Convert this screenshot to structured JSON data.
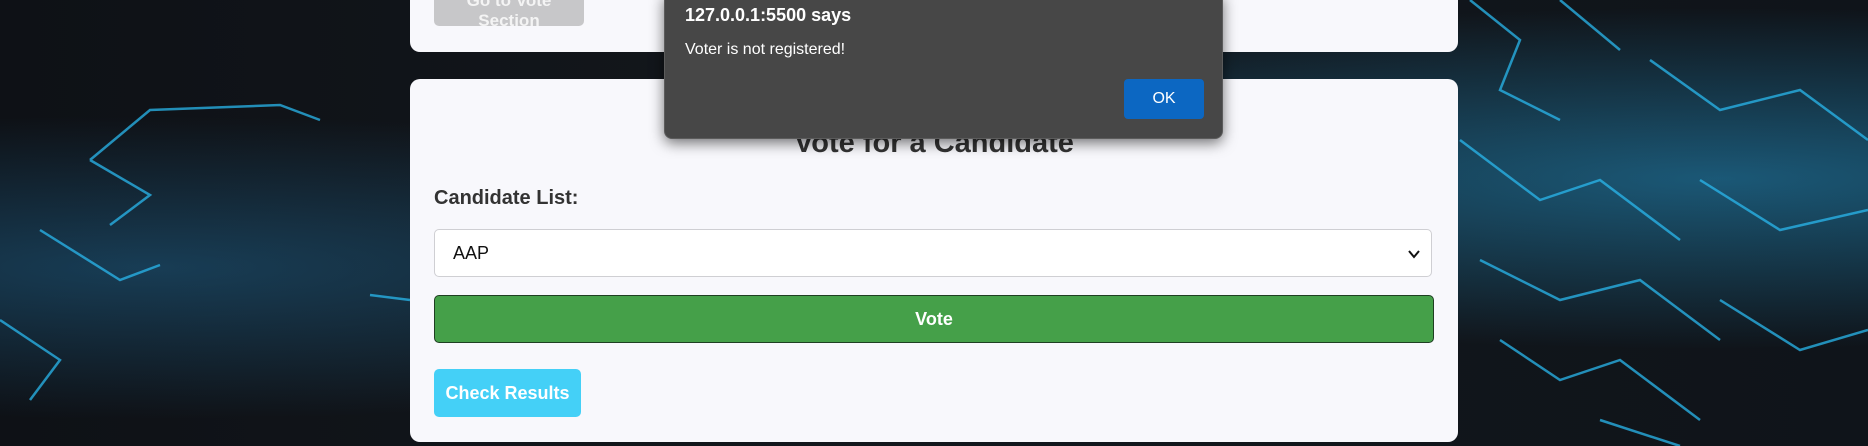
{
  "top_card": {
    "go_to_vote_label": "Go to Vote Section"
  },
  "vote_card": {
    "title": "Vote for a Candidate",
    "candidate_label": "Candidate List:",
    "selected_candidate": "AAP",
    "vote_label": "Vote",
    "check_results_label": "Check Results"
  },
  "dialog": {
    "origin": "127.0.0.1:5500 says",
    "message": "Voter is not registered!",
    "ok_label": "OK"
  },
  "colors": {
    "vote_button": "#45a049",
    "results_button": "#44d0f7",
    "dialog_ok": "#0c67c2",
    "background_circuit": "#28b8f0"
  },
  "icons": {
    "select_arrow": "chevron-down-icon"
  }
}
